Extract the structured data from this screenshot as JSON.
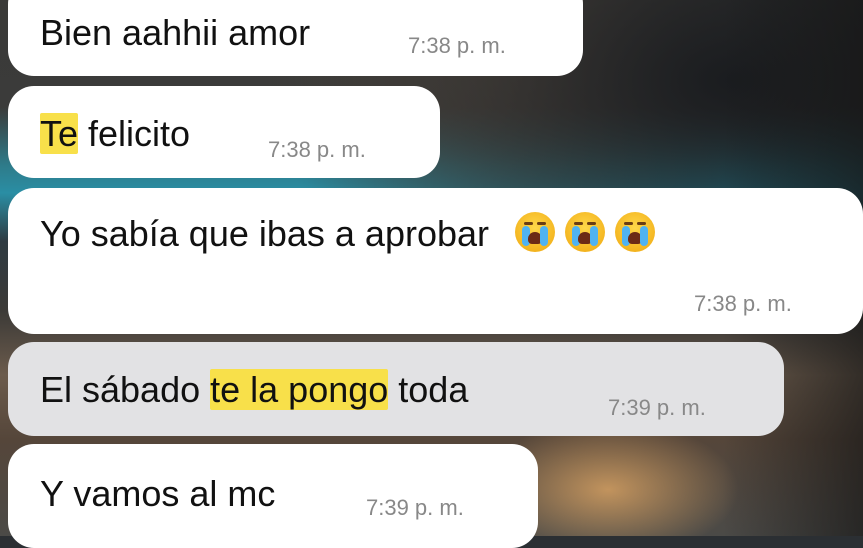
{
  "messages": [
    {
      "segments": [
        {
          "text": "Bien aahhii amor",
          "highlight": false
        }
      ],
      "time": "7:38 p. m."
    },
    {
      "segments": [
        {
          "text": "Te",
          "highlight": true
        },
        {
          "text": " felicito",
          "highlight": false
        }
      ],
      "time": "7:38 p. m."
    },
    {
      "segments": [
        {
          "text": "Yo sabía que ibas a aprobar",
          "highlight": false
        }
      ],
      "emojis": [
        "loudly-crying-face-icon",
        "loudly-crying-face-icon",
        "loudly-crying-face-icon"
      ],
      "time": "7:38 p. m."
    },
    {
      "segments": [
        {
          "text": "El sábado ",
          "highlight": false
        },
        {
          "text": "te la pongo",
          "highlight": true
        },
        {
          "text": " toda",
          "highlight": false
        }
      ],
      "time": "7:39 p. m."
    },
    {
      "segments": [
        {
          "text": "Y vamos al mc",
          "highlight": false
        }
      ],
      "time": "7:39 p. m."
    }
  ],
  "colors": {
    "bubble": "#ffffff",
    "bubble_selected": "#e2e2e4",
    "highlight": "#f8e04a",
    "timestamp": "#888888",
    "text": "#111111"
  }
}
